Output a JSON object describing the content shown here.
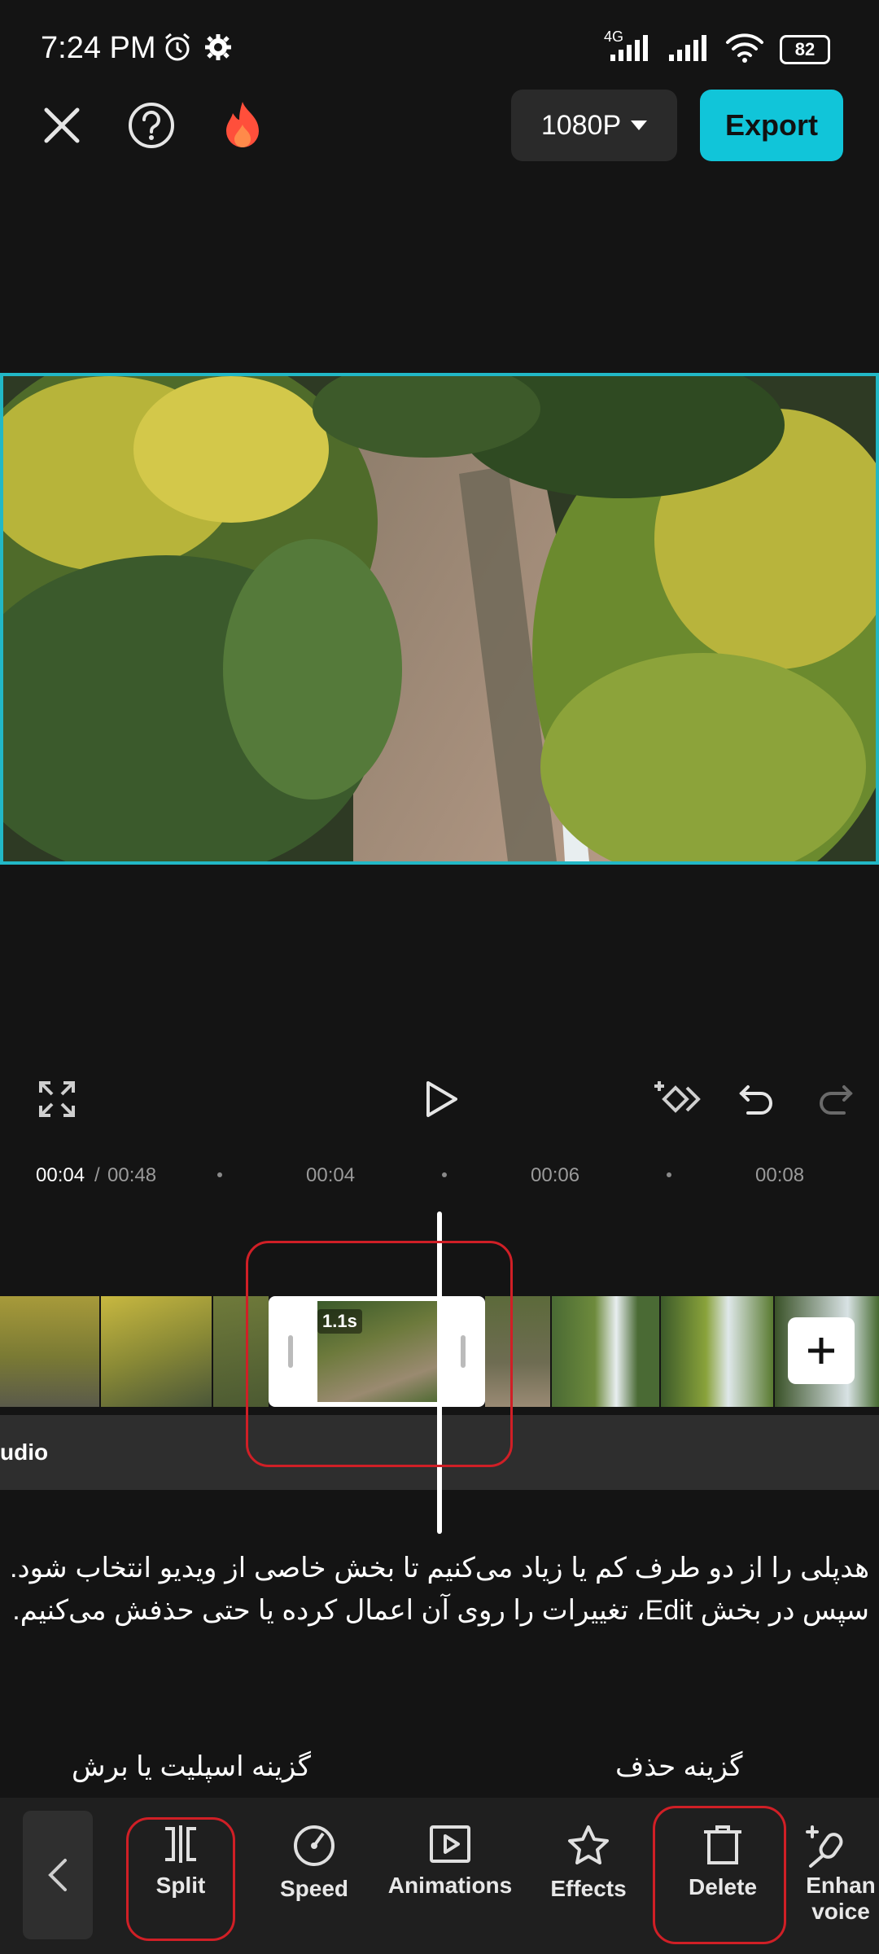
{
  "status": {
    "time": "7:24 PM",
    "network": "4G",
    "battery": "82"
  },
  "top_bar": {
    "resolution": "1080P",
    "export_label": "Export"
  },
  "timeline": {
    "current": "00:04",
    "separator": " / ",
    "total": "00:48",
    "ticks": [
      "00:04",
      "00:06",
      "00:08"
    ],
    "clip_duration": "1.1s"
  },
  "audio_track_label": "udio",
  "caption_text": "هدپلی را از دو طرف کم یا زیاد می‌کنیم تا بخش خاصی از ویدیو انتخاب شود. سپس در بخش Edit، تغییرات را روی آن اعمال کرده یا حتی حذفش می‌کنیم.",
  "annotations": {
    "split_label": "گزینه اسپلیت یا برش",
    "delete_label": "گزینه حذف"
  },
  "toolbar": {
    "items": [
      {
        "label": "Split",
        "icon": "split-icon"
      },
      {
        "label": "Speed",
        "icon": "speed-icon"
      },
      {
        "label": "Animations",
        "icon": "animations-icon"
      },
      {
        "label": "Effects",
        "icon": "effects-icon"
      },
      {
        "label": "Delete",
        "icon": "trash-icon"
      },
      {
        "label": "Enhan voice",
        "icon": "enhance-voice-icon"
      }
    ]
  },
  "colors": {
    "accent": "#11c5d9",
    "highlight": "#d01f26",
    "background": "#141414"
  }
}
